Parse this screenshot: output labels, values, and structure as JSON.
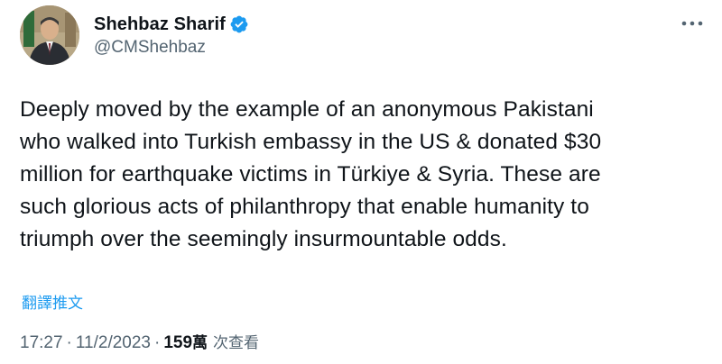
{
  "author": {
    "display_name": "Shehbaz Sharif",
    "handle": "@CMShehbaz",
    "avatar_icon": "avatar-photo",
    "verified_icon": "verified-badge-icon",
    "verified_color": "#1d9bf0"
  },
  "more_icon": "more-options-icon",
  "tweet": {
    "lines": [
      "Deeply moved by the example of an anonymous Pakistani",
      "who walked into Turkish embassy in the US & donated $30",
      "million for earthquake victims in Türkiye & Syria. These are",
      "such glorious acts of philanthropy that enable humanity to",
      "triumph over the seemingly insurmountable odds."
    ]
  },
  "translate_label": "翻譯推文",
  "meta": {
    "time": "17:27",
    "separator": "·",
    "date": "11/2/2023",
    "views_number": "159",
    "views_unit": "萬",
    "views_label": "次查看"
  },
  "colors": {
    "text": "#0f1419",
    "secondary": "#536471",
    "accent": "#1d9bf0"
  }
}
